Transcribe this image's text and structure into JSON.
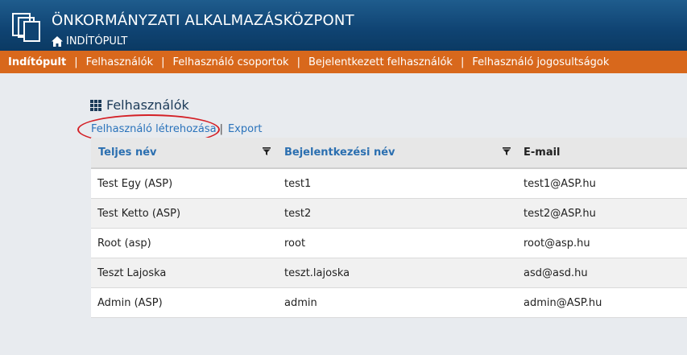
{
  "header": {
    "title": "ÖNKORMÁNYZATI ALKALMAZÁSKÖZPONT",
    "breadcrumb": "INDÍTÓPULT"
  },
  "nav": {
    "items": [
      "Indítópult",
      "Felhasználók",
      "Felhasználó csoportok",
      "Bejelentkezett felhasználók",
      "Felhasználó jogosultságok"
    ],
    "separator": "|"
  },
  "section": {
    "title": "Felhasználók",
    "create_link": "Felhasználó létrehozása",
    "separator": "|",
    "export_link": "Export"
  },
  "table": {
    "columns": [
      "Teljes név",
      "Bejelentkezési név",
      "E-mail"
    ],
    "rows": [
      [
        "Test Egy (ASP)",
        "test1",
        "test1@ASP.hu"
      ],
      [
        "Test Ketto (ASP)",
        "test2",
        "test2@ASP.hu"
      ],
      [
        "Root (asp)",
        "root",
        "root@asp.hu"
      ],
      [
        "Teszt Lajoska",
        "teszt.lajoska",
        "asd@asd.hu"
      ],
      [
        "Admin (ASP)",
        "admin",
        "admin@ASP.hu"
      ]
    ]
  },
  "colors": {
    "header_bg": "#0f4372",
    "nav_bg": "#d8681c",
    "link": "#2a73bb",
    "annotation": "#d42026"
  }
}
